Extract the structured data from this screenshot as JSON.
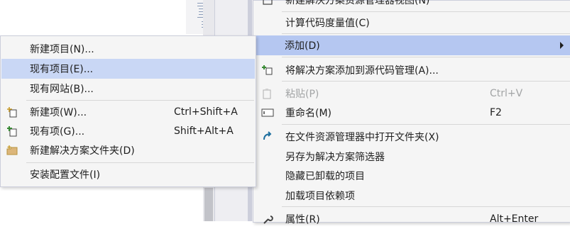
{
  "submenu": {
    "items": [
      {
        "label": "新建项目(N)...",
        "shortcut": ""
      },
      {
        "label": "现有项目(E)...",
        "shortcut": ""
      },
      {
        "label": "现有网站(B)...",
        "shortcut": ""
      },
      {
        "label": "新建项(W)...",
        "shortcut": "Ctrl+Shift+A",
        "icon": "new-item-icon"
      },
      {
        "label": "现有项(G)...",
        "shortcut": "Shift+Alt+A",
        "icon": "existing-item-icon"
      },
      {
        "label": "新建解决方案文件夹(D)",
        "shortcut": "",
        "icon": "solution-folder-icon"
      },
      {
        "label": "安装配置文件(I)",
        "shortcut": ""
      }
    ]
  },
  "mainmenu": {
    "items": [
      {
        "label": "新建解决方案资源管理器视图(N)",
        "shortcut": ""
      },
      {
        "label": "计算代码度量值(C)",
        "shortcut": ""
      },
      {
        "label": "添加(D)",
        "shortcut": ""
      },
      {
        "label": "将解决方案添加到源代码管理(A)...",
        "shortcut": "",
        "icon": "add-to-source-control-icon"
      },
      {
        "label": "粘贴(P)",
        "shortcut": "Ctrl+V",
        "icon": "paste-icon"
      },
      {
        "label": "重命名(M)",
        "shortcut": "F2",
        "icon": "rename-icon"
      },
      {
        "label": "在文件资源管理器中打开文件夹(X)",
        "shortcut": "",
        "icon": "open-folder-icon"
      },
      {
        "label": "另存为解决方案筛选器",
        "shortcut": ""
      },
      {
        "label": "隐藏已卸载的项目",
        "shortcut": ""
      },
      {
        "label": "加载项目依赖项",
        "shortcut": ""
      },
      {
        "label": "属性(R)",
        "shortcut": "Alt+Enter",
        "icon": "wrench-icon"
      }
    ]
  },
  "colors": {
    "menu_bg": "#f5f5f5",
    "hover": "#c9d7f5",
    "disabled_text": "#a2a4a5",
    "accent_icon": "#1e6f9f"
  }
}
